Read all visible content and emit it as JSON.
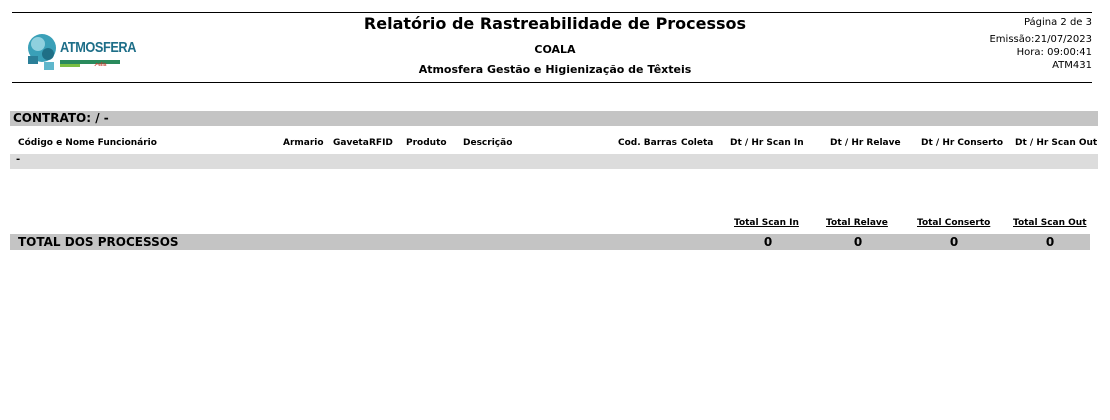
{
  "header": {
    "logo_text": "ATMOSFERA",
    "title": "Relatório de Rastreabilidade de Processos",
    "client": "COALA",
    "company": "Atmosfera Gestão e Higienização de Têxteis",
    "page": "Página 2 de 3",
    "emission": "Emissão:21/07/2023",
    "time": "Hora: 09:00:41",
    "report_code": "ATM431"
  },
  "contract": {
    "label": "CONTRATO:  /  -"
  },
  "columns": {
    "employee": "Código e Nome Funcionário",
    "locker": "Armario",
    "drawer": "Gaveta",
    "rfid": "RFID",
    "product": "Produto",
    "description": "Descrição",
    "barcode": "Cod. Barras",
    "collection": "Coleta",
    "scan_in": "Dt / Hr Scan In",
    "relave": "Dt / Hr Relave",
    "repair": "Dt / Hr Conserto",
    "scan_out": "Dt / Hr Scan Out"
  },
  "row": {
    "text": "-"
  },
  "totals": {
    "scan_in_label": "Total Scan In",
    "relave_label": "Total Relave",
    "repair_label": "Total Conserto",
    "scan_out_label": "Total Scan Out",
    "label": "TOTAL DOS PROCESSOS",
    "scan_in": "0",
    "relave": "0",
    "repair": "0",
    "scan_out": "0"
  }
}
